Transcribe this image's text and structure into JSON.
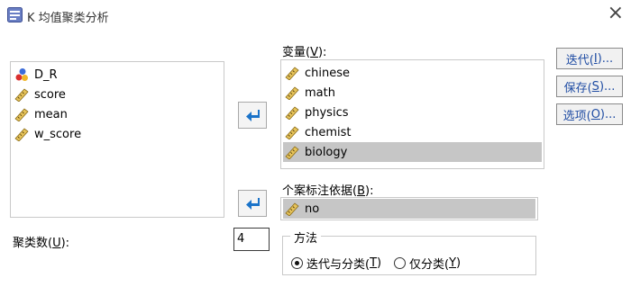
{
  "window": {
    "title": "K 均值聚类分析",
    "close_glyph": "×"
  },
  "source_list": {
    "items": [
      {
        "label": "D_R",
        "icon": "nominal-variable-icon"
      },
      {
        "label": "score",
        "icon": "ruler-scale-icon"
      },
      {
        "label": "mean",
        "icon": "ruler-scale-icon"
      },
      {
        "label": "w_score",
        "icon": "ruler-scale-icon"
      }
    ]
  },
  "variables": {
    "label_prefix": "变量(",
    "label_hotkey": "V",
    "label_suffix": "):",
    "items": [
      {
        "label": "chinese",
        "icon": "ruler-scale-icon",
        "selected": false
      },
      {
        "label": "math",
        "icon": "ruler-scale-icon",
        "selected": false
      },
      {
        "label": "physics",
        "icon": "ruler-scale-icon",
        "selected": false
      },
      {
        "label": "chemist",
        "icon": "ruler-scale-icon",
        "selected": false
      },
      {
        "label": "biology",
        "icon": "ruler-scale-icon",
        "selected": true
      }
    ]
  },
  "case_label": {
    "label_prefix": "个案标注依据(",
    "label_hotkey": "B",
    "label_suffix": "):",
    "value": "no",
    "icon": "ruler-scale-icon"
  },
  "clusters": {
    "label_prefix": "聚类数(",
    "label_hotkey": "U",
    "label_suffix": "):",
    "value": "4"
  },
  "method": {
    "legend": "方法",
    "options": [
      {
        "prefix": "迭代与分类(",
        "hotkey": "T",
        "suffix": ")",
        "checked": true
      },
      {
        "prefix": "仅分类(",
        "hotkey": "Y",
        "suffix": ")",
        "checked": false
      }
    ]
  },
  "side_buttons": [
    {
      "prefix": "迭代(",
      "hotkey": "I",
      "suffix": ")..."
    },
    {
      "prefix": "保存(",
      "hotkey": "S",
      "suffix": ")..."
    },
    {
      "prefix": "选项(",
      "hotkey": "O",
      "suffix": ")..."
    }
  ],
  "arrow_icon": "arrow-left-icon",
  "colors": {
    "selected_row": "#c6c6c6",
    "button_text": "#1f4ca3",
    "arrow_blue": "#1a73c9"
  }
}
